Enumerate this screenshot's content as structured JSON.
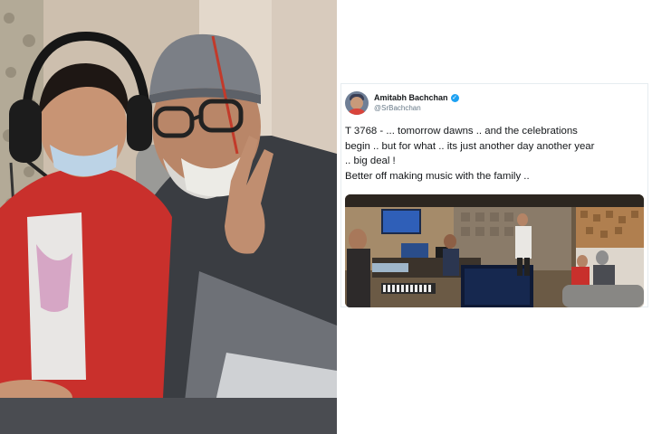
{
  "tweet": {
    "display_name": "Amitabh Bachchan",
    "verified_icon": "verified-badge-icon",
    "handle": "@SrBachchan",
    "text_lines": [
      "T 3768 - ... tomorrow dawns .. and the celebrations",
      "begin .. but for what .. its just another day another year",
      ".. big deal !",
      "Better off making music with the family  .."
    ]
  },
  "images": {
    "left_photo": "photo-of-child-and-man-in-studio",
    "tweet_media": "photo-of-recording-studio"
  },
  "colors": {
    "verified_blue": "#1da1f2",
    "text_primary": "#14171a",
    "text_secondary": "#657786",
    "card_border": "#e6ecf0"
  }
}
